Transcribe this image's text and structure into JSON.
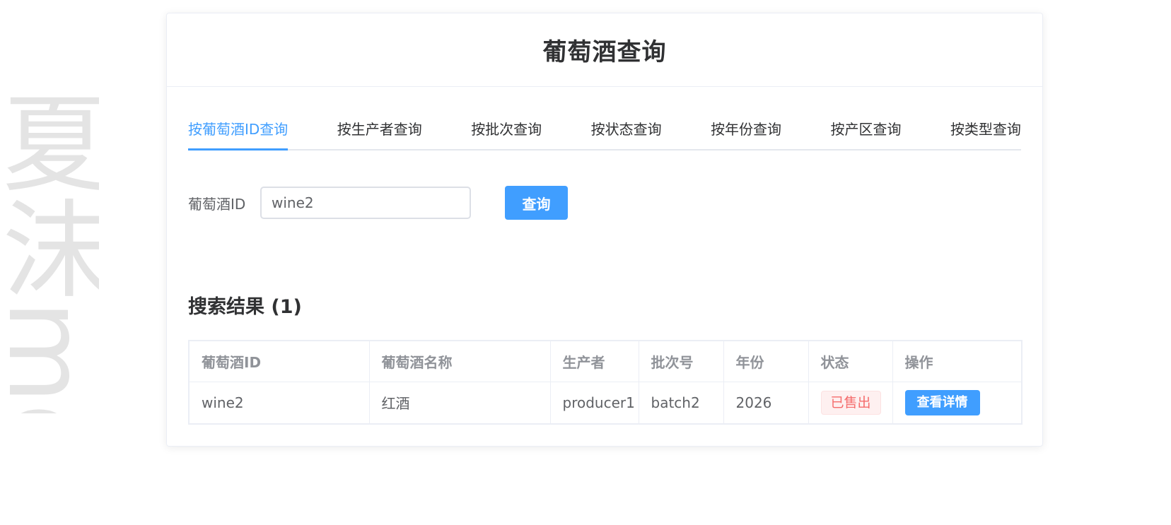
{
  "watermark": "夏沫mds",
  "page": {
    "title": "葡萄酒查询"
  },
  "tabs": [
    {
      "label": "按葡萄酒ID查询",
      "active": true
    },
    {
      "label": "按生产者查询",
      "active": false
    },
    {
      "label": "按批次查询",
      "active": false
    },
    {
      "label": "按状态查询",
      "active": false
    },
    {
      "label": "按年份查询",
      "active": false
    },
    {
      "label": "按产区查询",
      "active": false
    },
    {
      "label": "按类型查询",
      "active": false
    }
  ],
  "search": {
    "label": "葡萄酒ID",
    "value": "wine2",
    "button_label": "查询"
  },
  "results": {
    "title": "搜索结果 (1)",
    "columns": [
      "葡萄酒ID",
      "葡萄酒名称",
      "生产者",
      "批次号",
      "年份",
      "状态",
      "操作"
    ],
    "rows": [
      {
        "id": "wine2",
        "name": "红酒",
        "producer": "producer1",
        "batch": "batch2",
        "year": "2026",
        "status": "已售出",
        "action": "查看详情"
      }
    ]
  },
  "colors": {
    "accent": "#409eff",
    "status_sold_text": "#f56c6c",
    "status_sold_bg": "#fef0f0"
  }
}
